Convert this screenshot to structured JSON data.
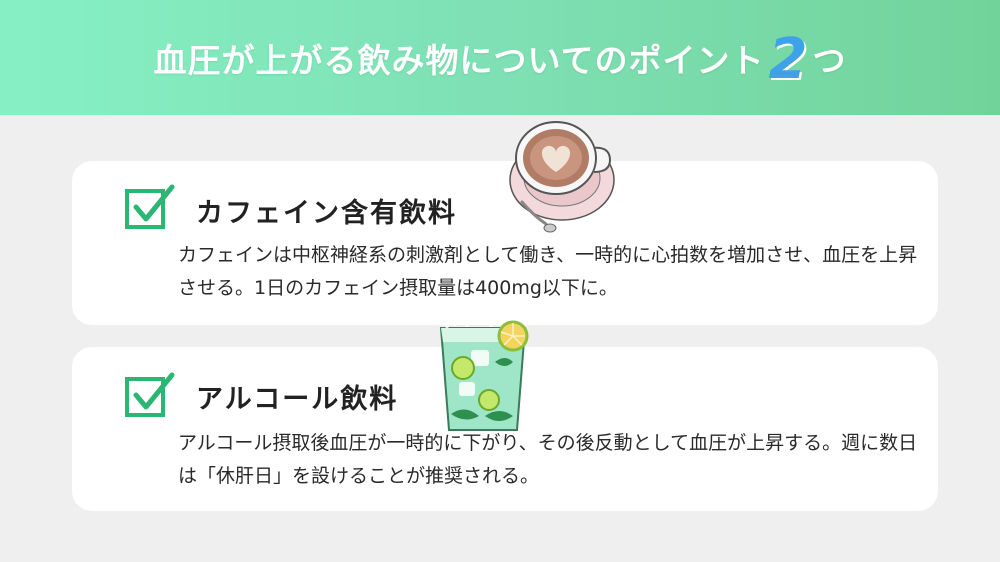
{
  "header": {
    "title_prefix": "血圧が上がる飲み物についてのポイント",
    "title_number": "2",
    "title_suffix": "つ"
  },
  "cards": [
    {
      "title": "カフェイン含有飲料",
      "description": "カフェインは中枢神経系の刺激剤として働き、一時的に心拍数を増加させ、血圧を上昇させる。1日のカフェイン摂取量は400mg以下に。",
      "illustration": "coffee-cup-icon"
    },
    {
      "title": "アルコール飲料",
      "description": "アルコール摂取後血圧が一時的に下がり、その後反動として血圧が上昇する。週に数日は「休肝日」を設けることが推奨される。",
      "illustration": "mojito-glass-icon"
    }
  ],
  "colors": {
    "header_gradient_start": "#86f0c4",
    "header_gradient_end": "#72d39a",
    "title_number": "#3fa1e8",
    "check": "#2bb673",
    "card_background": "#ffffff",
    "page_background": "#efefef"
  }
}
